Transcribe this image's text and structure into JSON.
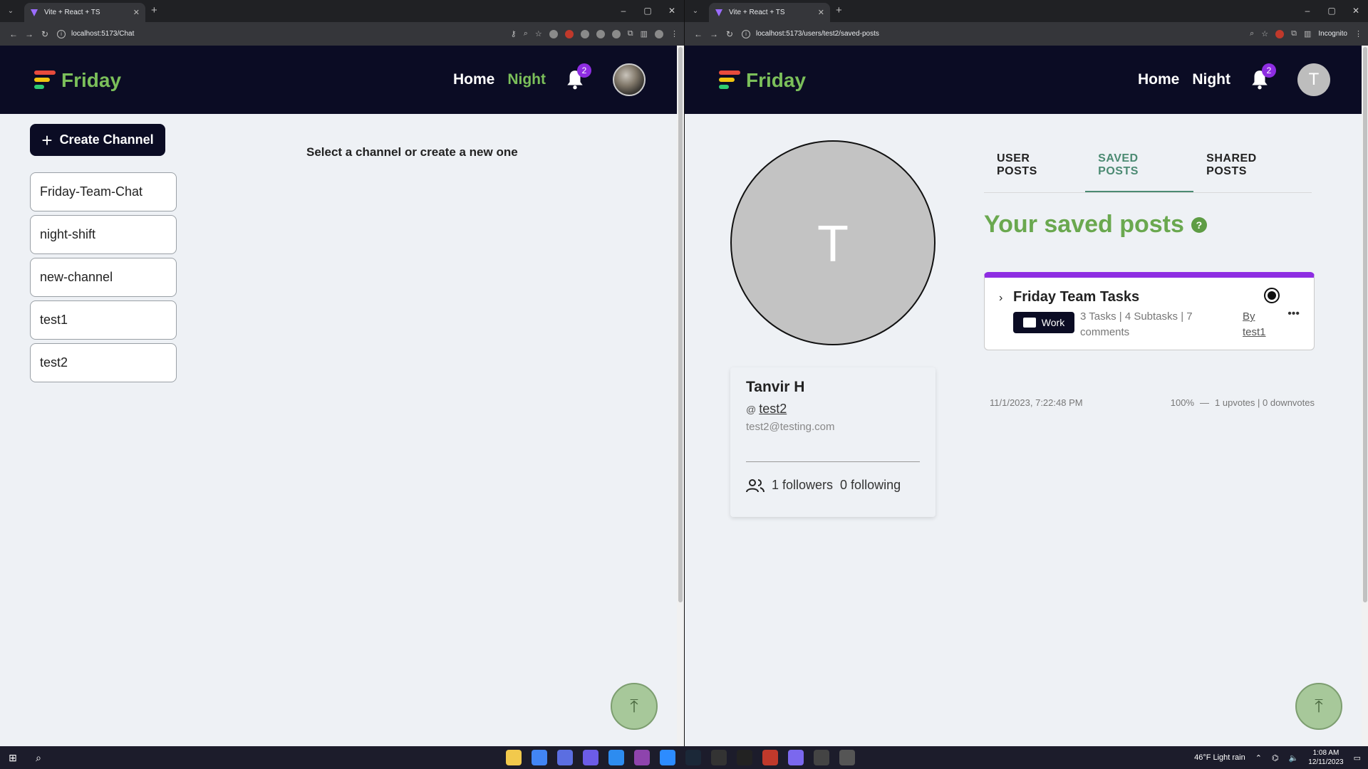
{
  "left_browser": {
    "tab_title": "Vite + React + TS",
    "url": "localhost:5173/Chat"
  },
  "right_browser": {
    "tab_title": "Vite + React + TS",
    "url": "localhost:5173/users/test2/saved-posts",
    "incognito_label": "Incognito"
  },
  "header": {
    "logo_text": "Friday",
    "nav_home": "Home",
    "nav_night": "Night",
    "notification_count": "2",
    "avatar_letter": "T"
  },
  "chat": {
    "create_channel_label": "Create Channel",
    "channels": [
      "Friday-Team-Chat",
      "night-shift",
      "new-channel",
      "test1",
      "test2"
    ],
    "empty_message": "Select a channel or create a new one"
  },
  "profile": {
    "avatar_letter": "T",
    "name": "Tanvir H",
    "username": "test2",
    "email": "test2@testing.com",
    "followers": "1 followers",
    "following": "0 following",
    "tabs": [
      "USER POSTS",
      "SAVED POSTS",
      "SHARED POSTS"
    ],
    "active_tab": "SAVED POSTS",
    "saved_heading": "Your saved posts",
    "help_icon": "?"
  },
  "post": {
    "title": "Friday Team Tasks",
    "category": "Work",
    "meta": "3 Tasks | 4 Subtasks | 7 comments",
    "author": "By test1",
    "date": "11/1/2023, 7:22:48 PM",
    "progress": "100%",
    "votes": "1 upvotes | 0 downvotes",
    "accent_color": "#8e2de2"
  },
  "taskbar": {
    "weather": "46°F Light rain",
    "time": "1:08 AM",
    "date": "12/11/2023"
  },
  "colors": {
    "header_bg": "#0b0c24",
    "brand_green": "#7bbf5a",
    "tab_active": "#4b8a72",
    "badge": "#8e2de2"
  }
}
